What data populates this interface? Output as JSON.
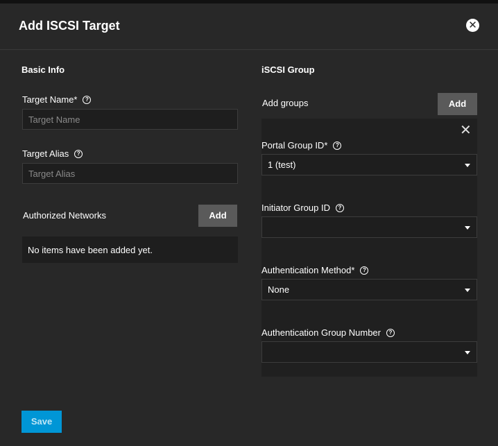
{
  "dialog": {
    "title": "Add ISCSI Target",
    "close_icon": "close-icon"
  },
  "basic_info": {
    "title": "Basic Info",
    "target_name": {
      "label": "Target Name",
      "required": "*",
      "placeholder": "Target Name",
      "value": ""
    },
    "target_alias": {
      "label": "Target Alias",
      "placeholder": "Target Alias",
      "value": ""
    },
    "authorized_networks": {
      "label": "Authorized Networks",
      "add_label": "Add",
      "empty_text": "No items have been added yet."
    }
  },
  "iscsi_group": {
    "title": "iSCSI Group",
    "add_groups_label": "Add groups",
    "add_label": "Add",
    "group": {
      "close_glyph": "✕",
      "portal_group_id": {
        "label": "Portal Group ID",
        "required": "*",
        "value": "1 (test)"
      },
      "initiator_group_id": {
        "label": "Initiator Group ID",
        "value": ""
      },
      "authentication_method": {
        "label": "Authentication Method",
        "required": "*",
        "value": "None"
      },
      "authentication_group_number": {
        "label": "Authentication Group Number",
        "value": ""
      }
    }
  },
  "footer": {
    "save_label": "Save"
  },
  "colors": {
    "accent": "#0096d6",
    "background": "#282828",
    "field": "#1e1e1e",
    "button": "#5a5a5a"
  },
  "help_glyph": "?",
  "close_glyph": "✕"
}
